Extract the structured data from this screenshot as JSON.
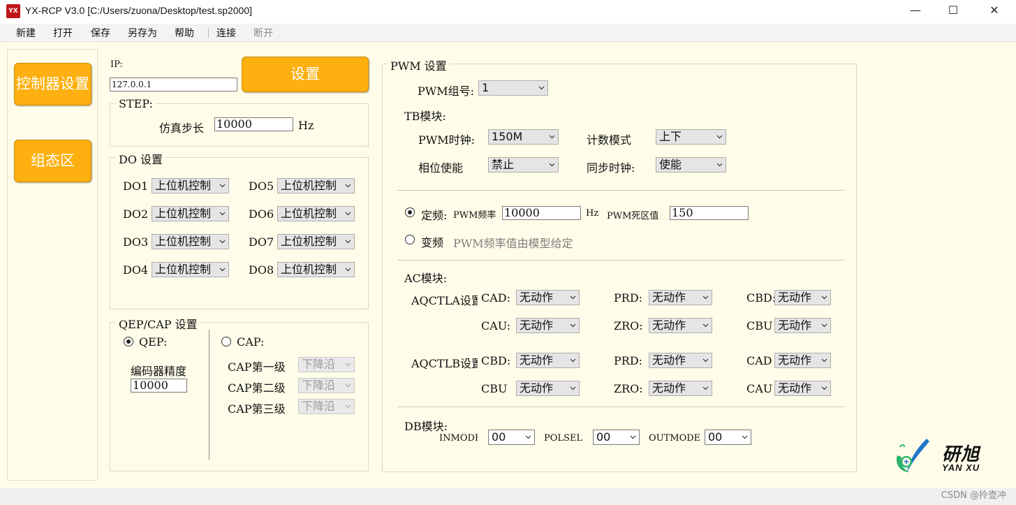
{
  "window": {
    "app_icon": "YX",
    "title": "YX-RCP V3.0 [C:/Users/zuona/Desktop/test.sp2000]",
    "minimize": "—",
    "maximize": "☐",
    "close": "✕"
  },
  "menu": [
    "新建",
    "打开",
    "保存",
    "另存为",
    "帮助",
    "连接",
    "断开"
  ],
  "sidebar": {
    "controller_btn": "控制器设置",
    "config_btn": "组态区"
  },
  "ip": {
    "label": "IP:",
    "value": "127.0.0.1",
    "set_btn": "设置"
  },
  "step": {
    "title": "STEP:",
    "label": "仿真步长",
    "value": "10000",
    "unit": "Hz"
  },
  "do": {
    "title": "DO 设置",
    "items": [
      {
        "label": "DO1",
        "value": "上位机控制"
      },
      {
        "label": "DO5",
        "value": "上位机控制"
      },
      {
        "label": "DO2",
        "value": "上位机控制"
      },
      {
        "label": "DO6",
        "value": "上位机控制"
      },
      {
        "label": "DO3",
        "value": "上位机控制"
      },
      {
        "label": "DO7",
        "value": "上位机控制"
      },
      {
        "label": "DO4",
        "value": "上位机控制"
      },
      {
        "label": "DO8",
        "value": "上位机控制"
      }
    ]
  },
  "qep": {
    "title": "QEP/CAP 设置",
    "qep_label": "QEP:",
    "encoder_label": "编码器精度",
    "encoder_value": "10000",
    "cap_label": "CAP:",
    "cap1_label": "CAP第一级",
    "cap1_value": "下降沿",
    "cap2_label": "CAP第二级",
    "cap2_value": "下降沿",
    "cap3_label": "CAP第三级",
    "cap3_value": "下降沿"
  },
  "pwm": {
    "title": "PWM 设置",
    "group_label": "PWM组号:",
    "group_value": "1",
    "tb_title": "TB模块:",
    "clock_label": "PWM时钟:",
    "clock_value": "150M",
    "count_label": "计数模式",
    "count_value": "上下",
    "phase_label": "相位使能",
    "phase_value": "禁止",
    "sync_label": "同步时钟:",
    "sync_value": "使能",
    "fixed_label": "定频:",
    "freq_label": "PWM频率",
    "freq_value": "10000",
    "freq_unit": "Hz",
    "dead_label": "PWM死区值",
    "dead_value": "150",
    "var_label": "变频",
    "var_desc": "PWM频率值由模型给定",
    "ac_title": "AC模块:",
    "aqctla_label": "AQCTLA设置",
    "aqctlb_label": "AQCTLB设置",
    "ac_rows_a": [
      [
        {
          "label": "CAD:",
          "value": "无动作"
        },
        {
          "label": "PRD:",
          "value": "无动作"
        },
        {
          "label": "CBD:",
          "value": "无动作"
        }
      ],
      [
        {
          "label": "CAU:",
          "value": "无动作"
        },
        {
          "label": "ZRO:",
          "value": "无动作"
        },
        {
          "label": "CBU",
          "value": "无动作"
        }
      ]
    ],
    "ac_rows_b": [
      [
        {
          "label": "CBD:",
          "value": "无动作"
        },
        {
          "label": "PRD:",
          "value": "无动作"
        },
        {
          "label": "CAD",
          "value": "无动作"
        }
      ],
      [
        {
          "label": "CBU",
          "value": "无动作"
        },
        {
          "label": "ZRO:",
          "value": "无动作"
        },
        {
          "label": "CAU",
          "value": "无动作"
        }
      ]
    ],
    "db_title": "DB模块:",
    "inmode_label": "INMODE",
    "inmode_value": "00",
    "polsel_label": "POLSEL",
    "polsel_value": "00",
    "outmode_label": "OUTMODE",
    "outmode_value": "00"
  },
  "logo": {
    "cn": "研旭",
    "en": "YAN XU"
  },
  "watermark": "CSDN @拎壶冲"
}
